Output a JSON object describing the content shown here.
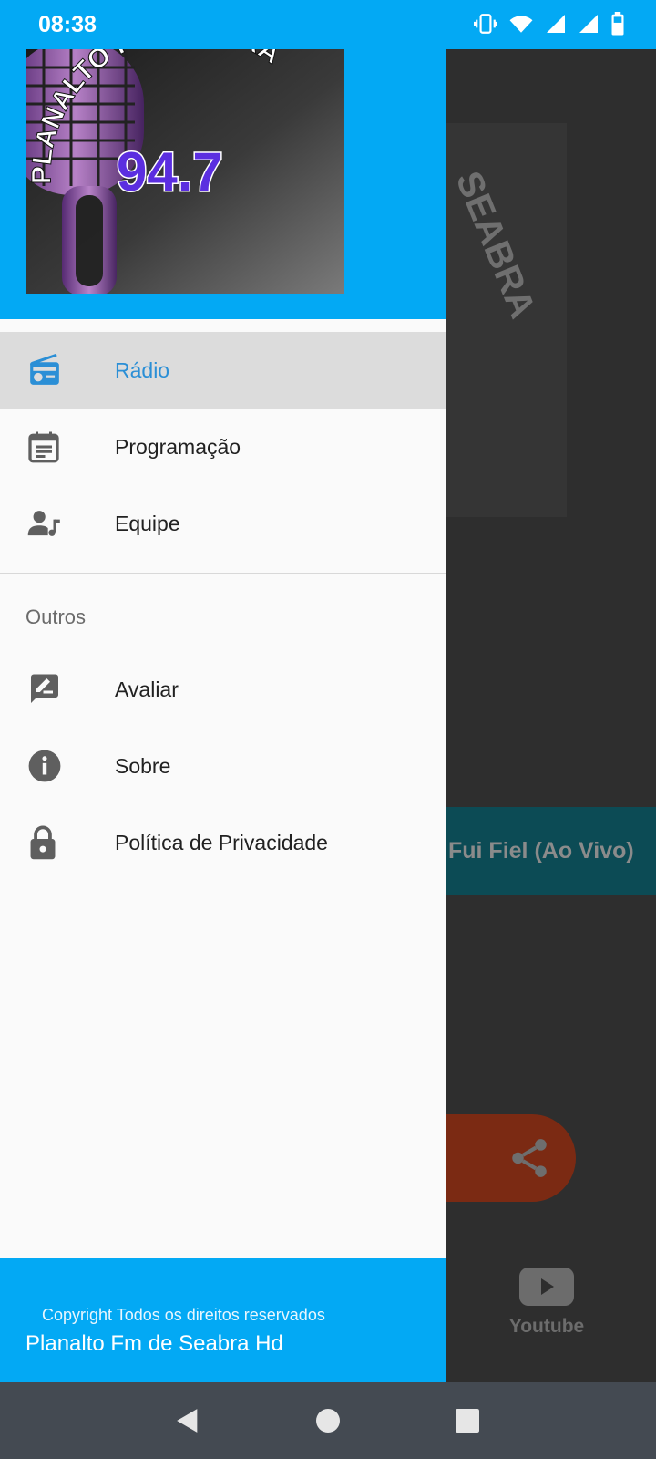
{
  "status_bar": {
    "time": "08:38",
    "icons": [
      "vibrate-icon",
      "wifi-icon",
      "signal-icon",
      "signal-icon",
      "battery-icon"
    ]
  },
  "background_app": {
    "logo_text": "SEABRA",
    "now_playing": "Fui Fiel (Ao Vivo)",
    "share_icon": "share-icon",
    "youtube_label": "Youtube"
  },
  "drawer": {
    "header_logo": {
      "title": "PLANALTO FM SEABRA",
      "frequency": "94.7"
    },
    "items": [
      {
        "label": "Rádio",
        "icon": "radio-icon",
        "active": true
      },
      {
        "label": "Programação",
        "icon": "schedule-icon",
        "active": false
      },
      {
        "label": "Equipe",
        "icon": "team-icon",
        "active": false
      }
    ],
    "section_title": "Outros",
    "other_items": [
      {
        "label": "Avaliar",
        "icon": "rate-icon"
      },
      {
        "label": "Sobre",
        "icon": "info-icon"
      },
      {
        "label": "Política de Privacidade",
        "icon": "lock-icon"
      }
    ],
    "footer": {
      "copyright": "Copyright Todos os direitos reservados",
      "app_name": "Planalto Fm de Seabra Hd"
    }
  },
  "colors": {
    "primary": "#03a9f4",
    "active_text": "#2b8fd6",
    "active_bg": "#dcdcdc",
    "scrim": "#2e2e2e"
  },
  "nav_bar": {
    "buttons": [
      "back-icon",
      "home-icon",
      "recents-icon"
    ]
  }
}
